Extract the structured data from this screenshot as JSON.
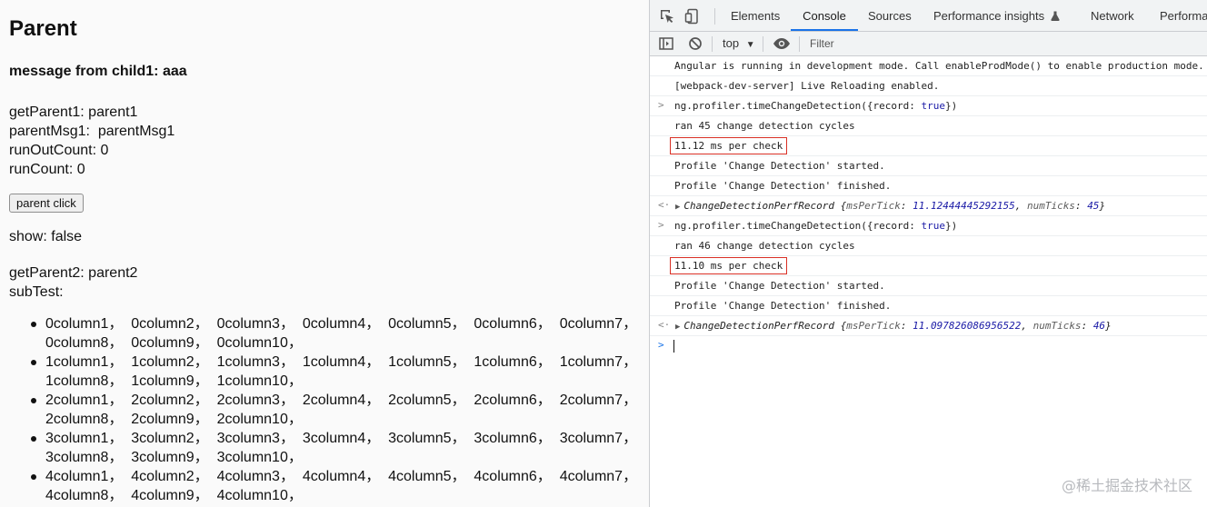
{
  "app": {
    "title": "Parent",
    "message": "message from child1: aaa",
    "lines": [
      "getParent1: parent1",
      "parentMsg1:  parentMsg1",
      "runOutCount: 0",
      "runCount: 0"
    ],
    "button_label": "parent click",
    "show": "show: false",
    "lines2": [
      "getParent2: parent2",
      "subTest:"
    ],
    "rows": [
      [
        "0column1，",
        "0column2，",
        "0column3，",
        "0column4，",
        "0column5，",
        "0column6，",
        "0column7，",
        "0column8，",
        "0column9，",
        "0column10，"
      ],
      [
        "1column1，",
        "1column2，",
        "1column3，",
        "1column4，",
        "1column5，",
        "1column6，",
        "1column7，",
        "1column8，",
        "1column9，",
        "1column10，"
      ],
      [
        "2column1，",
        "2column2，",
        "2column3，",
        "2column4，",
        "2column5，",
        "2column6，",
        "2column7，",
        "2column8，",
        "2column9，",
        "2column10，"
      ],
      [
        "3column1，",
        "3column2，",
        "3column3，",
        "3column4，",
        "3column5，",
        "3column6，",
        "3column7，",
        "3column8，",
        "3column9，",
        "3column10，"
      ],
      [
        "4column1，",
        "4column2，",
        "4column3，",
        "4column4，",
        "4column5，",
        "4column6，",
        "4column7，",
        "4column8，",
        "4column9，",
        "4column10，"
      ]
    ]
  },
  "devtools": {
    "tabs": [
      "Elements",
      "Console",
      "Sources",
      "Performance insights",
      "Network",
      "Performa"
    ],
    "active_tab": "Console",
    "context": "top",
    "filter_placeholder": "Filter",
    "accent_color": "#1a73e8",
    "highlight_color": "#d93025",
    "console": {
      "angular_msg": "Angular is running in development mode. Call enableProdMode() to enable production mode.",
      "webpack_msg": "[webpack-dev-server] Live Reloading enabled.",
      "cmd1_prefix": "ng.profiler.timeChangeDetection({record: ",
      "cmd_true": "true",
      "cmd_suffix": "})",
      "cycles1": "ran 45 change detection cycles",
      "perf1": "11.12 ms per check",
      "started": "Profile 'Change Detection' started.",
      "finished": "Profile 'Change Detection' finished.",
      "record_name": "ChangeDetectionPerfRecord",
      "key_ms": "msPerTick",
      "key_ticks": "numTicks",
      "record1_ms": "11.12444445292155",
      "record1_ticks": "45",
      "cycles2": "ran 46 change detection cycles",
      "perf2": "11.10 ms per check",
      "record2_ms": "11.097826086956522",
      "record2_ticks": "46"
    }
  },
  "watermark": "@稀土掘金技术社区"
}
